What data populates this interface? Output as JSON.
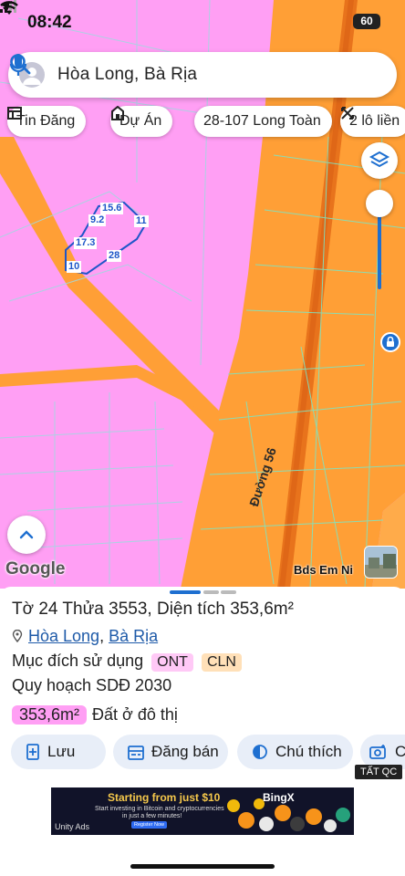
{
  "status_bar": {
    "time": "08:42",
    "battery": "60"
  },
  "search": {
    "query": "Hòa Long, Bà Rịa"
  },
  "chips": [
    {
      "label": "Tin Đăng",
      "icon": "listing-icon"
    },
    {
      "label": "Dự Án",
      "icon": "project-icon"
    },
    {
      "label": "28-107 Long Toàn",
      "icon": ""
    },
    {
      "label": "2 lô liền",
      "icon": "merge-icon"
    }
  ],
  "map": {
    "parcel_labels": [
      "15.6",
      "11",
      "9.2",
      "17.3",
      "28",
      "10"
    ],
    "road_label": "Đường 56",
    "google_logo": "Google",
    "credit": "Bds Em Ni"
  },
  "colors": {
    "residential": "#ff9ff4",
    "perennial_crop": "#ff9f36",
    "parcel_outline": "#1e56c8",
    "accent": "#1e6fd0"
  },
  "sheet": {
    "title": "Tờ 24 Thửa 3553, Diện tích 353,6m²",
    "location": {
      "commune": "Hòa Long",
      "separator": ", ",
      "city": "Bà Rịa"
    },
    "purpose_label": "Mục đích sử dụng",
    "purpose_tags": [
      "ONT",
      "CLN"
    ],
    "plan_label": "Quy hoạch SDĐ 2030",
    "area_value": "353,6m²",
    "area_type": "Đất ở đô thị",
    "actions": [
      {
        "label": "Lưu",
        "icon": "bookmark-add-icon"
      },
      {
        "label": "Đăng bán",
        "icon": "listing-icon"
      },
      {
        "label": "Chú thích",
        "icon": "contrast-icon"
      },
      {
        "label": "C",
        "icon": "camera-add-icon"
      }
    ],
    "ad_badge": "TẤT QC"
  },
  "ad": {
    "headline": "Starting from just $10",
    "line1": "Start investing in Bitcoin and cryptocurrencies",
    "line2": "in just a few minutes!",
    "cta": "Register Now",
    "brand": "BingX",
    "network": "Unity Ads"
  }
}
